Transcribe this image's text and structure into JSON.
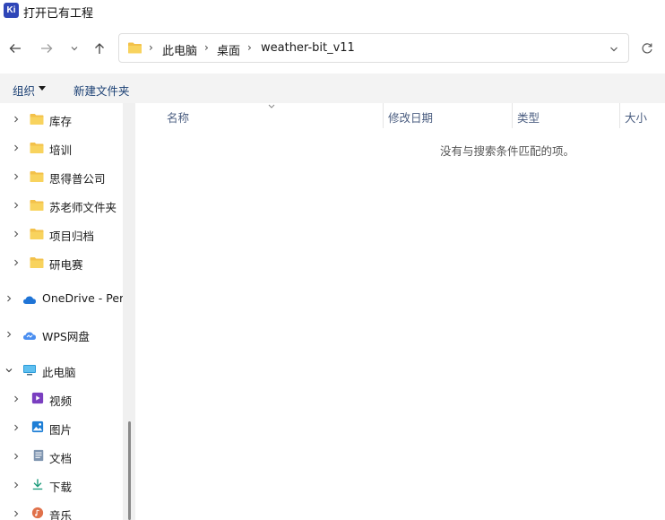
{
  "window": {
    "title": "打开已有工程",
    "app_icon_text": "Ki"
  },
  "nav": {
    "back_icon": "arrow-left-icon",
    "forward_icon": "arrow-right-icon",
    "recent_icon": "chevron-down-icon",
    "up_icon": "arrow-up-icon",
    "refresh_icon": "refresh-icon"
  },
  "address": {
    "breadcrumbs": [
      "此电脑",
      "桌面",
      "weather-bit_v11"
    ],
    "separator": "›"
  },
  "toolbar": {
    "organize_label": "组织",
    "new_folder_label": "新建文件夹"
  },
  "sidebar": {
    "items": [
      {
        "label": "库存",
        "icon": "folder-icon"
      },
      {
        "label": "培训",
        "icon": "folder-icon"
      },
      {
        "label": "思得普公司",
        "icon": "folder-icon"
      },
      {
        "label": "苏老师文件夹",
        "icon": "folder-icon"
      },
      {
        "label": "项目归档",
        "icon": "folder-icon"
      },
      {
        "label": "研电赛",
        "icon": "folder-icon"
      },
      {
        "label": "OneDrive - Pers",
        "icon": "cloud-icon"
      },
      {
        "label": "WPS网盘",
        "icon": "wps-cloud-icon"
      },
      {
        "label": "此电脑",
        "icon": "computer-icon"
      },
      {
        "label": "视频",
        "icon": "video-icon"
      },
      {
        "label": "图片",
        "icon": "pictures-icon"
      },
      {
        "label": "文档",
        "icon": "documents-icon"
      },
      {
        "label": "下载",
        "icon": "download-icon"
      },
      {
        "label": "音乐",
        "icon": "music-icon"
      }
    ]
  },
  "columns": {
    "name": "名称",
    "modified": "修改日期",
    "type": "类型",
    "size": "大小"
  },
  "content": {
    "empty_message": "没有与搜索条件匹配的项。"
  },
  "colors": {
    "folder": "#f3c14a",
    "accent": "#1a3f73",
    "header_text": "#4a5d80"
  }
}
